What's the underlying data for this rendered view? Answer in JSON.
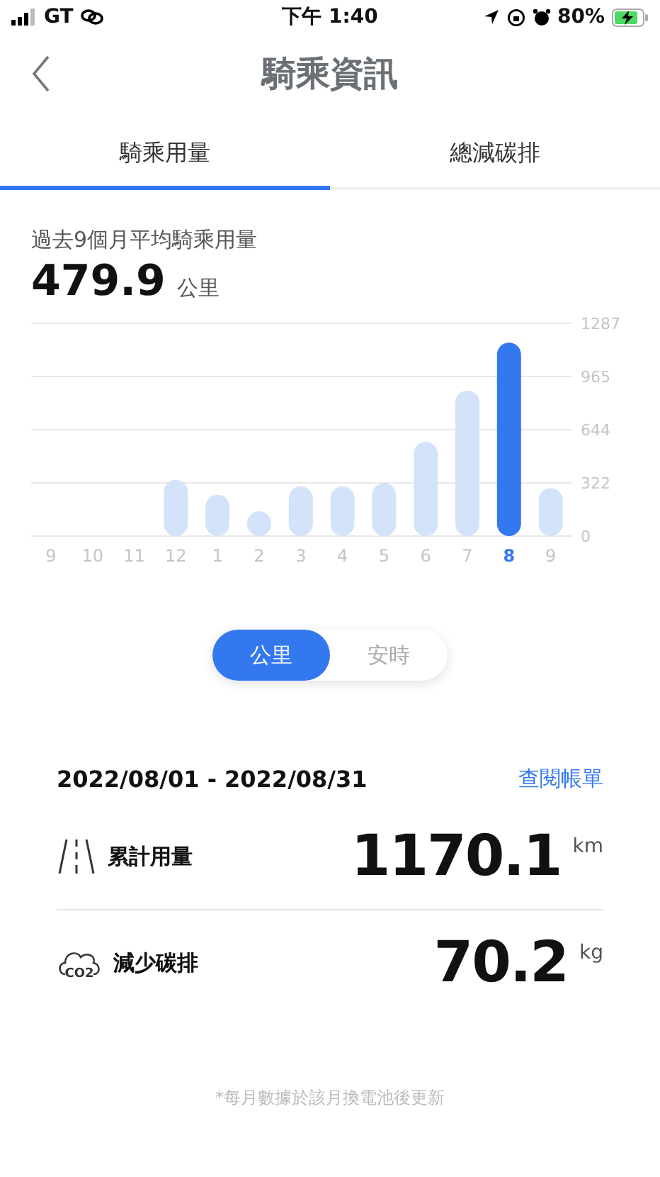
{
  "status_bar": {
    "carrier": "GT",
    "time": "下午 1:40",
    "battery": "80%"
  },
  "nav": {
    "title": "騎乘資訊"
  },
  "tabs": [
    {
      "label": "騎乘用量",
      "selected": true
    },
    {
      "label": "總減碳排",
      "selected": false
    }
  ],
  "summary": {
    "label": "過去9個月平均騎乘用量",
    "value": "479.9",
    "unit": "公里"
  },
  "chart": {
    "bars": [
      {
        "selected": false
      },
      {
        "selected": false
      },
      {
        "selected": false
      },
      {
        "selected": false
      },
      {
        "selected": false
      },
      {
        "selected": false
      },
      {
        "selected": false
      },
      {
        "selected": false
      },
      {
        "selected": false
      },
      {
        "selected": false
      },
      {
        "selected": false
      },
      {
        "selected": true
      },
      {
        "selected": false
      }
    ],
    "chart_data": {
      "type": "bar",
      "categories": [
        "9",
        "10",
        "11",
        "12",
        "1",
        "2",
        "3",
        "4",
        "5",
        "6",
        "7",
        "8",
        "9"
      ],
      "series": [
        {
          "values": [
            null,
            null,
            null,
            340,
            250,
            150,
            300,
            300,
            320,
            570,
            880,
            1170,
            290
          ]
        }
      ],
      "ylim": [
        0,
        1287
      ],
      "yticks": [
        0,
        322,
        644,
        965,
        1287
      ],
      "grid": true
    }
  },
  "unit_toggle": [
    {
      "label": "公里",
      "selected": true
    },
    {
      "label": "安時",
      "selected": false
    }
  ],
  "period": {
    "range": "2022/08/01 - 2022/08/31",
    "link": "查閱帳單"
  },
  "stats": [
    {
      "kind": "road",
      "label": "累計用量",
      "value": "1170.1",
      "unit": "km"
    },
    {
      "kind": "co2",
      "icon_text": "CO2",
      "label": "減少碳排",
      "value": "70.2",
      "unit": "kg"
    }
  ],
  "footnote": "*每月數據於該月換電池後更新"
}
